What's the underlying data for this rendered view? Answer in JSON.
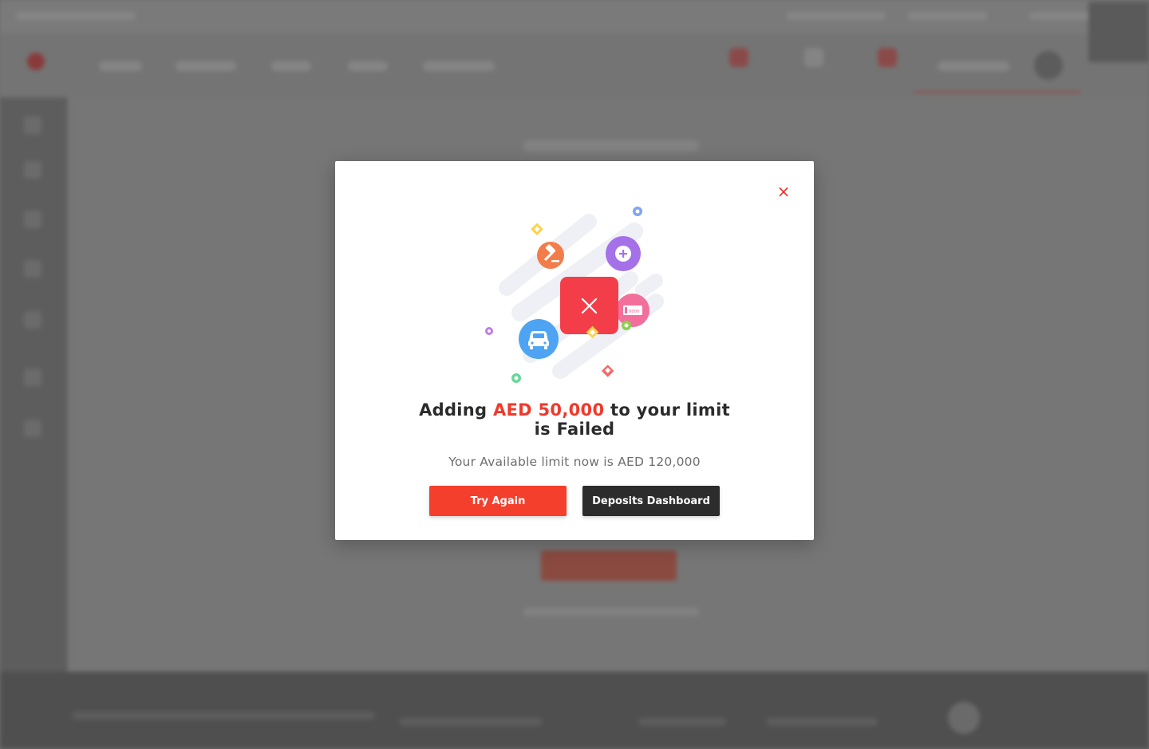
{
  "modal": {
    "close_symbol": "×",
    "title_prefix": "Adding ",
    "title_amount": "AED 50,000",
    "title_suffix_line1": " to your limit",
    "title_line2": "is Failed",
    "subtitle": "Your Available limit now is AED 120,000",
    "try_again_label": "Try Again",
    "dashboard_label": "Deposits Dashboard",
    "illustration_icons": [
      "x-icon",
      "gavel-icon",
      "plus-icon",
      "car-icon",
      "plate-icon"
    ]
  },
  "colors": {
    "accent": "#f43f2d",
    "dark_button": "#2c2c2c",
    "overlay": "#6f6f6f"
  }
}
